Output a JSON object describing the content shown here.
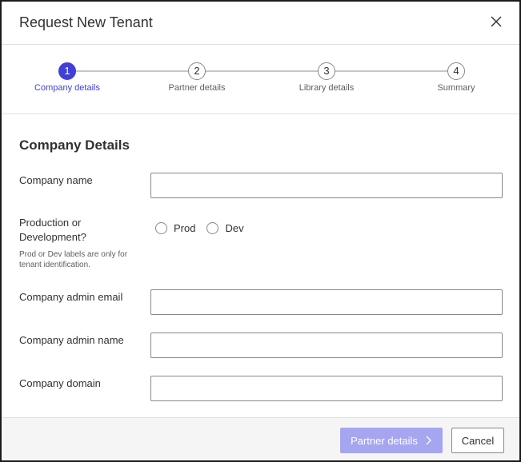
{
  "dialog": {
    "title": "Request New Tenant"
  },
  "steps": [
    {
      "number": "1",
      "label": "Company details",
      "active": true
    },
    {
      "number": "2",
      "label": "Partner details",
      "active": false
    },
    {
      "number": "3",
      "label": "Library details",
      "active": false
    },
    {
      "number": "4",
      "label": "Summary",
      "active": false
    }
  ],
  "form": {
    "section_title": "Company Details",
    "company_name": {
      "label": "Company name",
      "value": "",
      "placeholder": ""
    },
    "environment": {
      "label_line1": "Production or",
      "label_line2": "Development?",
      "hint": "Prod or Dev labels are only for tenant identification.",
      "options": [
        "Prod",
        "Dev"
      ],
      "selected": ""
    },
    "admin_email": {
      "label": "Company admin email",
      "value": "",
      "placeholder": ""
    },
    "admin_name": {
      "label": "Company admin name",
      "value": "",
      "placeholder": ""
    },
    "domain": {
      "label": "Company domain",
      "value": "",
      "placeholder": ""
    }
  },
  "footer": {
    "next_label": "Partner details",
    "cancel_label": "Cancel"
  },
  "colors": {
    "accent": "#4040d6",
    "accent_disabled": "#a6a6f0",
    "border": "#8a8886"
  },
  "icons": {
    "close": "close-icon",
    "next": "chevron-right-icon"
  }
}
